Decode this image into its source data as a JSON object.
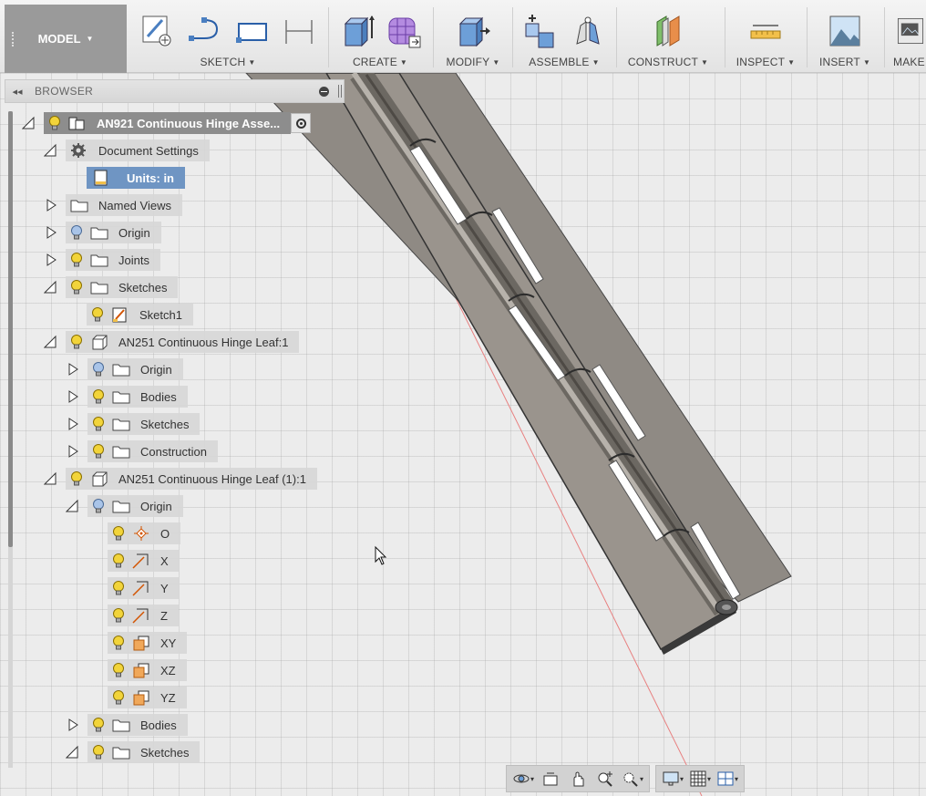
{
  "toolbar": {
    "model_label": "MODEL",
    "groups": [
      {
        "label": "SKETCH",
        "icons": [
          "sketch-create-icon",
          "sketch-arc-icon",
          "sketch-rectangle-icon",
          "sketch-dimension-icon"
        ]
      },
      {
        "label": "CREATE",
        "icons": [
          "extrude-icon",
          "form-icon"
        ]
      },
      {
        "label": "MODIFY",
        "icons": [
          "press-pull-icon"
        ]
      },
      {
        "label": "ASSEMBLE",
        "icons": [
          "new-component-icon",
          "joint-icon"
        ]
      },
      {
        "label": "CONSTRUCT",
        "icons": [
          "offset-plane-icon"
        ]
      },
      {
        "label": "INSPECT",
        "icons": [
          "measure-icon"
        ]
      },
      {
        "label": "INSERT",
        "icons": [
          "insert-image-icon"
        ]
      },
      {
        "label": "MAKE",
        "icons": [
          "make-3d-print-icon"
        ]
      }
    ]
  },
  "browser": {
    "title": "BROWSER",
    "items": [
      {
        "label": "AN921 Continuous Hinge Asse...",
        "kind": "root"
      },
      {
        "label": "Document Settings",
        "kind": "settings"
      },
      {
        "label": "Units: in",
        "kind": "units"
      },
      {
        "label": "Named Views",
        "kind": "folder"
      },
      {
        "label": "Origin",
        "kind": "folder"
      },
      {
        "label": "Joints",
        "kind": "folder"
      },
      {
        "label": "Sketches",
        "kind": "folder"
      },
      {
        "label": "Sketch1",
        "kind": "sketch"
      },
      {
        "label": "AN251 Continuous Hinge Leaf:1",
        "kind": "component"
      },
      {
        "label": "Origin",
        "kind": "folder"
      },
      {
        "label": "Bodies",
        "kind": "folder"
      },
      {
        "label": "Sketches",
        "kind": "folder"
      },
      {
        "label": "Construction",
        "kind": "folder"
      },
      {
        "label": "AN251 Continuous Hinge Leaf (1):1",
        "kind": "component"
      },
      {
        "label": "Origin",
        "kind": "folder"
      },
      {
        "label": "O",
        "kind": "point"
      },
      {
        "label": "X",
        "kind": "axis"
      },
      {
        "label": "Y",
        "kind": "axis"
      },
      {
        "label": "Z",
        "kind": "axis"
      },
      {
        "label": "XY",
        "kind": "plane"
      },
      {
        "label": "XZ",
        "kind": "plane"
      },
      {
        "label": "YZ",
        "kind": "plane"
      },
      {
        "label": "Bodies",
        "kind": "folder"
      },
      {
        "label": "Sketches",
        "kind": "folder"
      }
    ]
  },
  "navbar": {
    "icons": [
      "orbit-icon",
      "look-at-icon",
      "pan-icon",
      "zoom-icon",
      "fit-icon",
      "display-settings-icon",
      "grid-settings-icon",
      "viewports-icon"
    ]
  },
  "colors": {
    "model_button": "#9a9a9a",
    "units_highlight": "#6f95c3",
    "root_highlight": "#8d8d8d",
    "bulb_on": "#f2d43a",
    "bulb_off": "#a9c4e8",
    "hinge_leaf": "#8f8a84",
    "axis_line": "#e88080"
  }
}
